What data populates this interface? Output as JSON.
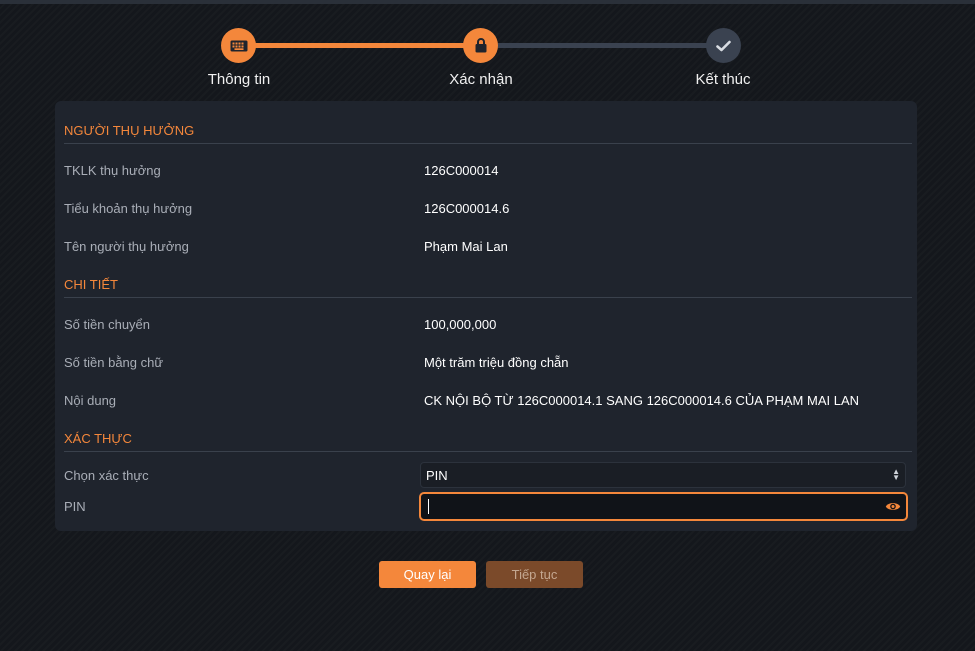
{
  "stepper": {
    "steps": [
      {
        "label": "Thông tin",
        "icon": "keyboard-icon",
        "state": "done"
      },
      {
        "label": "Xác nhận",
        "icon": "lock-icon",
        "state": "active"
      },
      {
        "label": "Kết thúc",
        "icon": "check-icon",
        "state": "pending"
      }
    ]
  },
  "beneficiary": {
    "title": "NGƯỜI THỤ HƯỞNG",
    "rows": [
      {
        "label": "TKLK thụ hưởng",
        "value": "126C000014"
      },
      {
        "label": "Tiểu khoản thụ hưởng",
        "value": "126C000014.6"
      },
      {
        "label": "Tên người thụ hưởng",
        "value": "Phạm Mai Lan"
      }
    ]
  },
  "details": {
    "title": "CHI TIẾT",
    "rows": [
      {
        "label": "Số tiền chuyển",
        "value": "100,000,000"
      },
      {
        "label": "Số tiền bằng chữ",
        "value": "Một trăm triệu đồng chẵn"
      },
      {
        "label": "Nội dung",
        "value": "CK NỘI BỘ TỪ 126C000014.1 SANG 126C000014.6 CỦA PHẠM MAI LAN"
      }
    ]
  },
  "auth": {
    "title": "XÁC THỰC",
    "method_label": "Chọn xác thực",
    "method_value": "PIN",
    "pin_label": "PIN",
    "pin_value": ""
  },
  "buttons": {
    "back": "Quay lại",
    "next": "Tiếp tục"
  },
  "colors": {
    "accent": "#f4873b",
    "panel": "#1f242d",
    "disabled_button": "#7b4a2a"
  }
}
